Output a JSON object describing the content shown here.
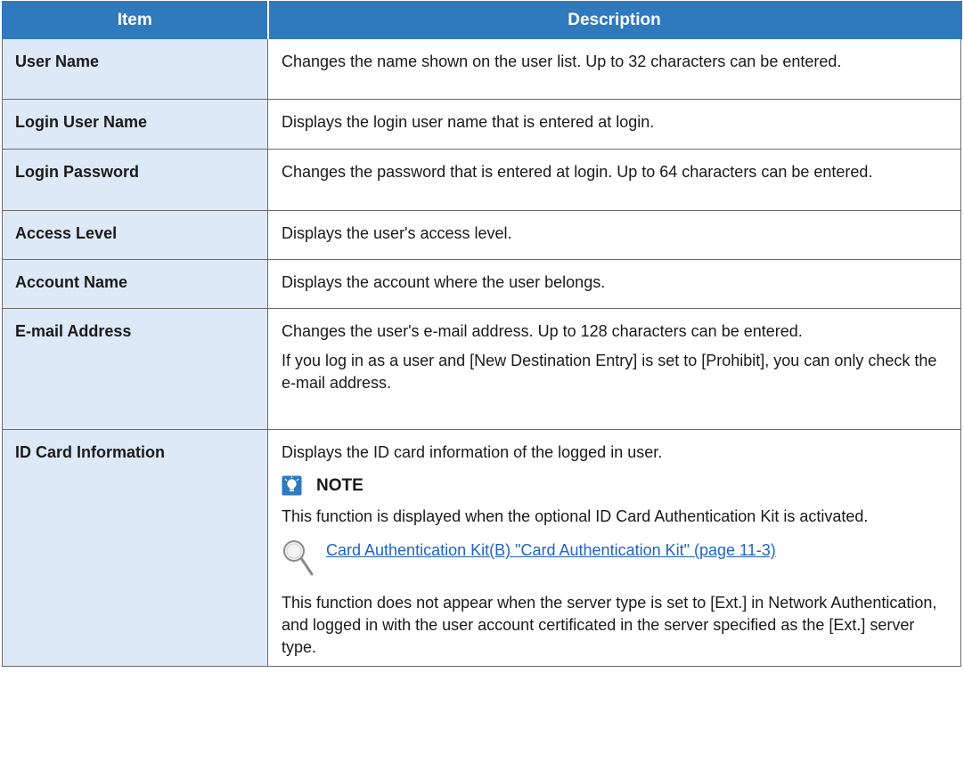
{
  "table": {
    "headers": {
      "item": "Item",
      "description": "Description"
    },
    "rows": [
      {
        "item": "User Name",
        "description": [
          "Changes the name shown on the user list. Up to 32 characters can be entered."
        ]
      },
      {
        "item": "Login User Name",
        "description": [
          "Displays the login user name that is entered at login."
        ]
      },
      {
        "item": "Login Password",
        "description": [
          "Changes the password that is entered at login. Up to 64 characters can be entered."
        ]
      },
      {
        "item": "Access Level",
        "description": [
          "Displays the user's access level."
        ]
      },
      {
        "item": "Account Name",
        "description": [
          "Displays the account where the user belongs."
        ]
      },
      {
        "item": "E-mail Address",
        "description": [
          "Changes the user's e-mail address. Up to 128 characters can be entered.",
          "If you log in as a user and [New Destination Entry] is set to [Prohibit], you can only check the e-mail address."
        ]
      },
      {
        "item": "ID Card Information",
        "description": [
          "Displays the ID card information of the logged in user."
        ],
        "note": {
          "label": "NOTE",
          "text": "This function is displayed when the optional ID Card Authentication Kit is activated.",
          "reference_link": "Card Authentication Kit(B) \"Card Authentication Kit\" (page 11-3)",
          "footer": "This function does not appear when the server type is set to [Ext.] in Network Authentication, and logged in with the user account certificated in the server specified as the [Ext.] server type."
        }
      }
    ]
  },
  "icons": {
    "note": "lightbulb-note-icon",
    "reference": "magnifier-icon"
  },
  "colors": {
    "header_bg": "#2f79bd",
    "item_cell_bg": "#dde9f6",
    "link": "#1f63c9"
  }
}
